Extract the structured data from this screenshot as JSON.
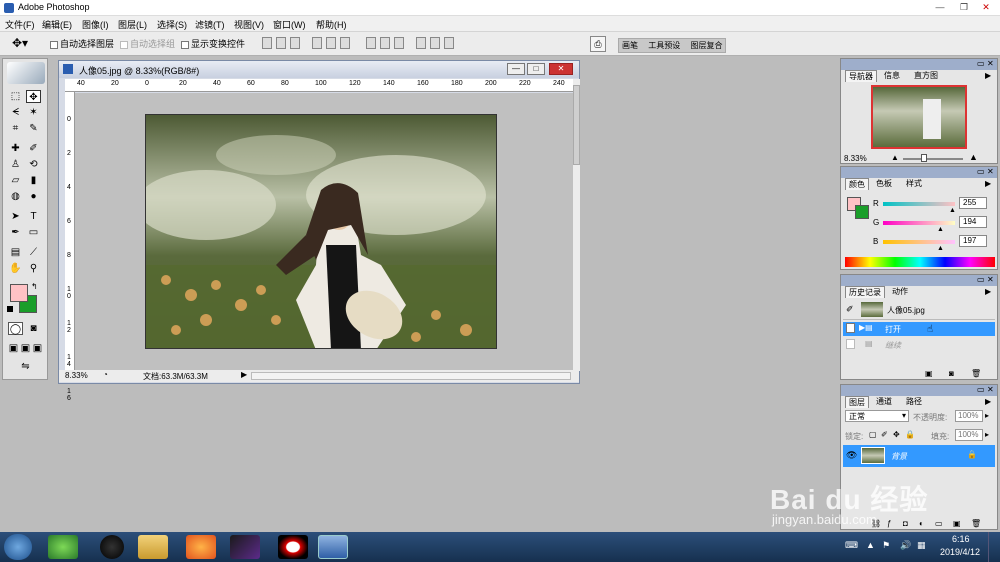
{
  "app": {
    "title": "Adobe Photoshop"
  },
  "menu": [
    "文件(F)",
    "编辑(E)",
    "图像(I)",
    "图层(L)",
    "选择(S)",
    "滤镜(T)",
    "视图(V)",
    "窗口(W)",
    "帮助(H)"
  ],
  "options": {
    "auto_select_layer": "自动选择图层",
    "auto_select_group": "自动选择组",
    "show_transform": "显示变换控件",
    "well": [
      "画笔",
      "工具预设",
      "图层复合"
    ]
  },
  "document": {
    "title": "人像05.jpg @ 8.33%(RGB/8#)",
    "zoom": "8.33%",
    "status": "文档:63.3M/63.3M",
    "ruler_top": [
      "40",
      "20",
      "0",
      "20",
      "40",
      "60",
      "80",
      "100",
      "120",
      "140",
      "160",
      "180",
      "200",
      "220",
      "240"
    ],
    "ruler_left": [
      "0",
      "2",
      "4",
      "6",
      "8",
      "1\n0",
      "1\n2",
      "1\n4",
      "1\n6"
    ]
  },
  "navigator": {
    "tabs": [
      "导航器",
      "信息",
      "直方图"
    ],
    "zoom": "8.33%"
  },
  "color": {
    "tabs": [
      "颜色",
      "色板",
      "样式"
    ],
    "r_label": "R",
    "g_label": "G",
    "b_label": "B",
    "r": "255",
    "g": "194",
    "b": "197",
    "foreground": "#ffc2c5",
    "background": "#1a9e2a"
  },
  "history": {
    "tabs": [
      "历史记录",
      "动作"
    ],
    "snapshot": "人像05.jpg",
    "items": [
      "打开",
      "继续"
    ]
  },
  "layers": {
    "tabs": [
      "图层",
      "通道",
      "路径"
    ],
    "blend_mode": "正常",
    "opacity_label": "不透明度:",
    "opacity": "100%",
    "lock_label": "锁定:",
    "fill_label": "填充:",
    "fill": "100%",
    "layer_name": "背景"
  },
  "watermark": {
    "brand": "Bai du 经验",
    "url": "jingyan.baidu.com"
  },
  "taskbar": {
    "time": "6:16",
    "date": "2019/4/12"
  },
  "accent": "#3399ff"
}
